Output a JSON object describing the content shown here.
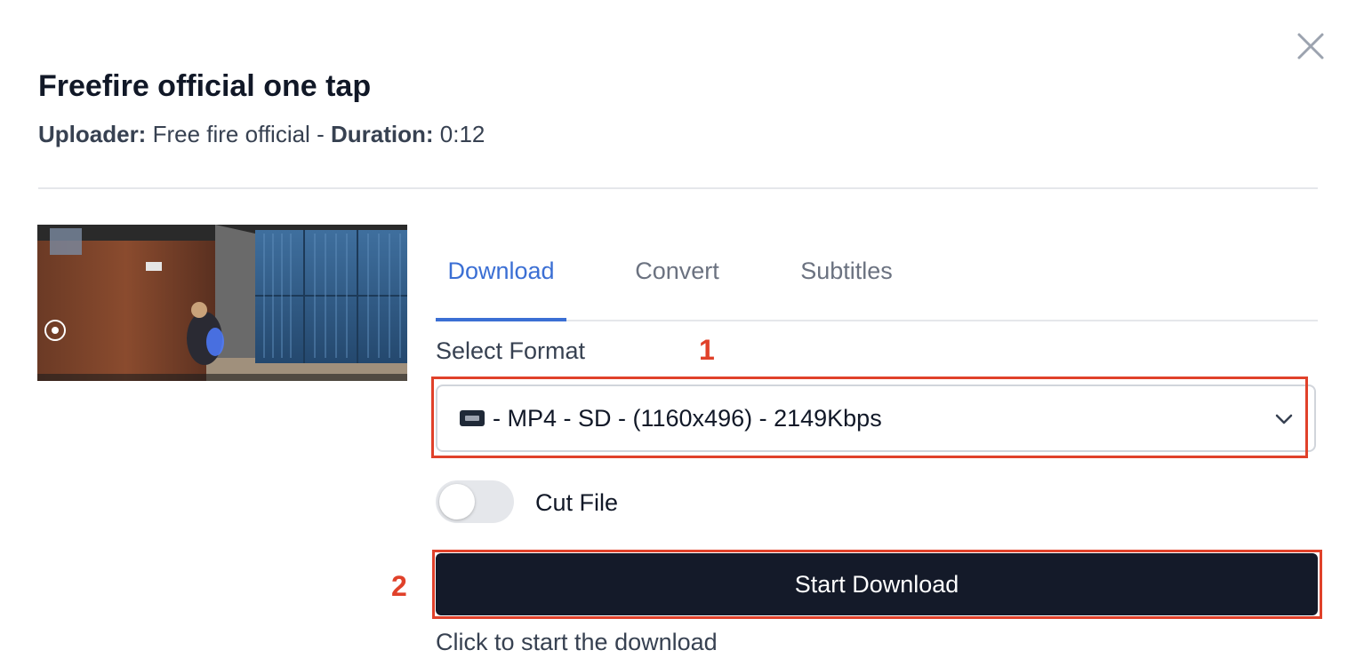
{
  "dialog": {
    "title": "Freefire official one tap",
    "uploader_label": "Uploader:",
    "uploader_value": "Free fire official",
    "separator": "-",
    "duration_label": "Duration:",
    "duration_value": "0:12"
  },
  "tabs": [
    {
      "label": "Download",
      "active": true
    },
    {
      "label": "Convert",
      "active": false
    },
    {
      "label": "Subtitles",
      "active": false
    }
  ],
  "format": {
    "label": "Select Format",
    "icon": "vhs-cassette-icon",
    "selected": "- MP4 - SD - (1160x496) - 2149Kbps"
  },
  "cut_file": {
    "label": "Cut File",
    "enabled": false
  },
  "start_button": {
    "label": "Start Download"
  },
  "hint": "Click to start the download",
  "annotations": {
    "step1": "1",
    "step2": "2"
  },
  "colors": {
    "accent": "#3b6fd4",
    "button_bg": "#141a29",
    "annotation": "#e0412a"
  }
}
